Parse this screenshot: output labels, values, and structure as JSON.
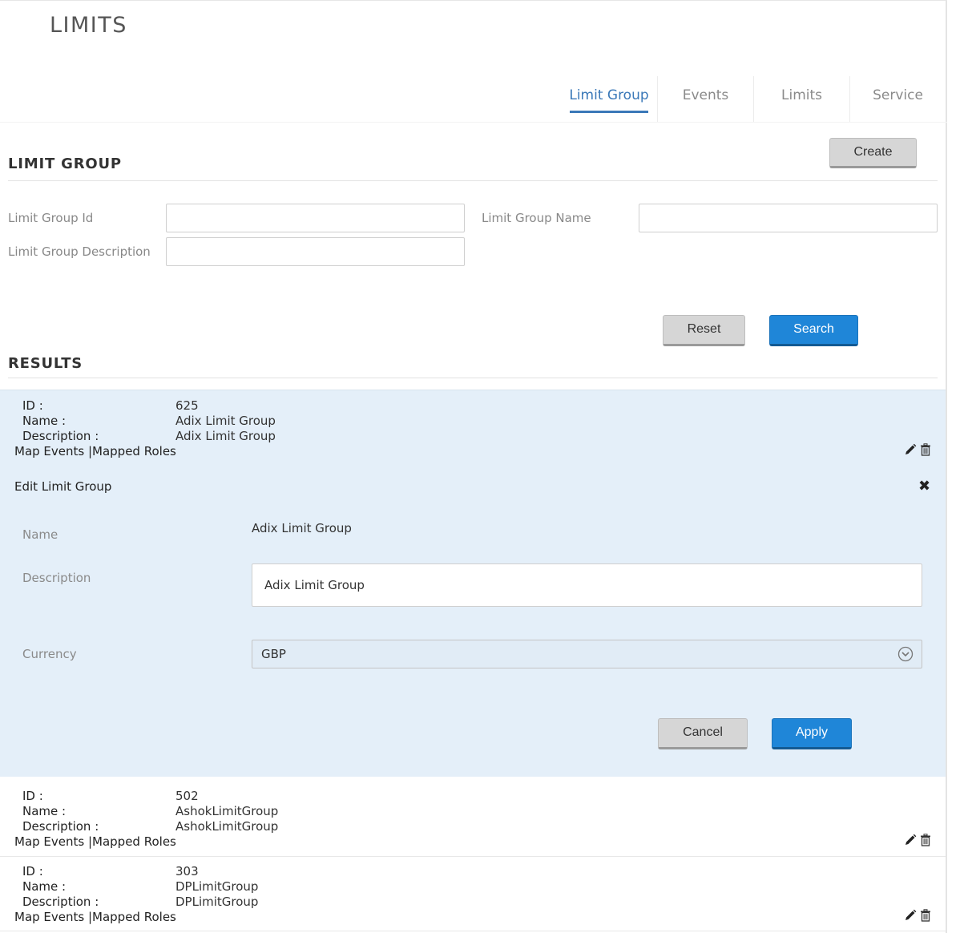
{
  "page": {
    "title": "LIMITS"
  },
  "tabs": [
    {
      "label": "Limit Group",
      "active": true
    },
    {
      "label": "Events",
      "active": false
    },
    {
      "label": "Limits",
      "active": false
    },
    {
      "label": "Service",
      "active": false
    }
  ],
  "limit_group": {
    "title": "LIMIT GROUP",
    "create_label": "Create",
    "fields": {
      "id_label": "Limit Group Id",
      "id_value": "",
      "name_label": "Limit Group Name",
      "name_value": "",
      "description_label": "Limit Group Description",
      "description_value": ""
    },
    "reset_label": "Reset",
    "search_label": "Search"
  },
  "results": {
    "title": "RESULTS",
    "keys": {
      "id": "ID :",
      "name": "Name :",
      "description": "Description :"
    },
    "links_label": "Map Events |Mapped Roles",
    "records": [
      {
        "id": "625",
        "name": "Adix Limit Group",
        "description": "Adix Limit Group"
      },
      {
        "id": "502",
        "name": "AshokLimitGroup",
        "description": "AshokLimitGroup"
      },
      {
        "id": "303",
        "name": "DPLimitGroup",
        "description": "DPLimitGroup"
      }
    ]
  },
  "edit": {
    "title": "Edit Limit Group",
    "name_label": "Name",
    "name_value": "Adix Limit Group",
    "description_label": "Description",
    "description_value": "Adix Limit Group",
    "currency_label": "Currency",
    "currency_value": "GBP",
    "cancel_label": "Cancel",
    "apply_label": "Apply"
  },
  "icons": {
    "edit": "pencil-icon",
    "delete": "trash-icon",
    "close": "close-icon",
    "select": "chevron-down-circle-icon"
  },
  "colors": {
    "accent": "#3a78b8",
    "primary_button": "#1f86d8",
    "secondary_button": "#d6d6d6",
    "selected_row": "#e4eff9"
  }
}
